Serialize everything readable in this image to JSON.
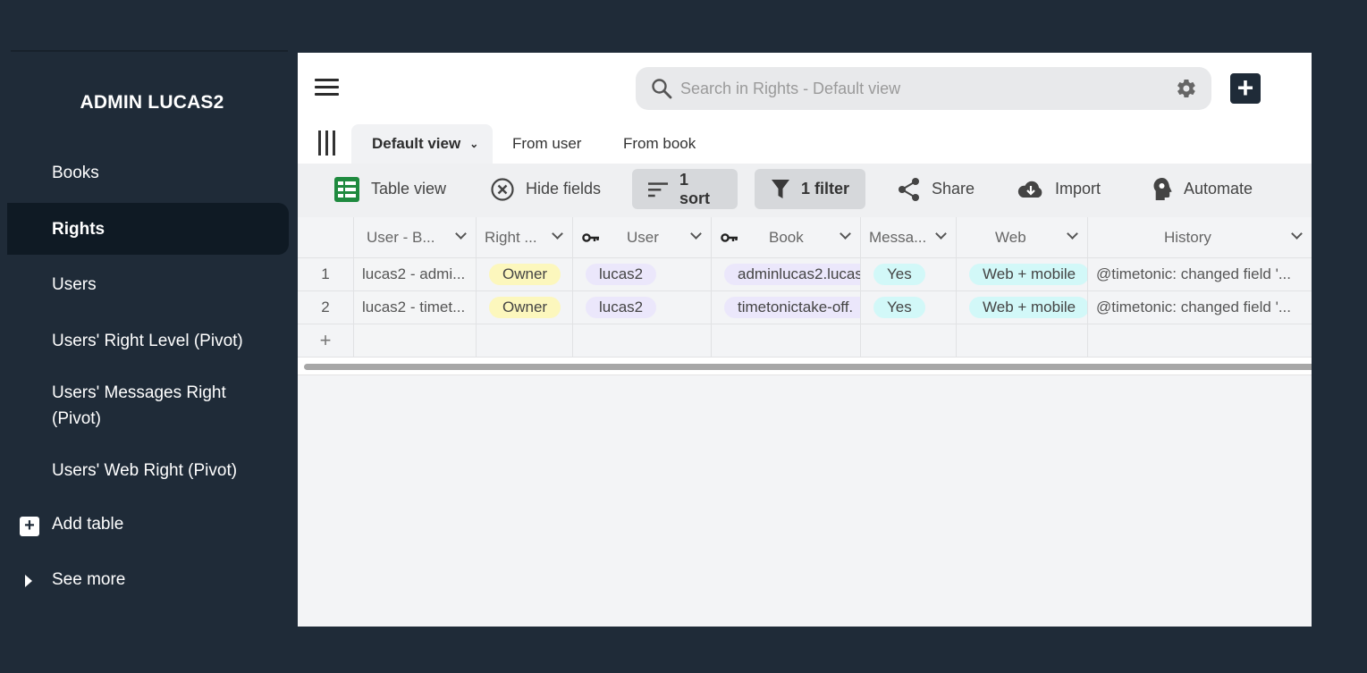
{
  "sidebar": {
    "title": "ADMIN LUCAS2",
    "items": [
      {
        "label": "Books",
        "active": false
      },
      {
        "label": "Rights",
        "active": true
      },
      {
        "label": "Users",
        "active": false
      },
      {
        "label": "Users' Right Level (Pivot)",
        "active": false
      },
      {
        "label": "Users' Messages Right (Pivot)",
        "active": false
      },
      {
        "label": "Users' Web Right (Pivot)",
        "active": false
      }
    ],
    "add_table_label": "Add table",
    "see_more_label": "See more"
  },
  "search": {
    "placeholder": "Search in Rights - Default view"
  },
  "tabs": [
    {
      "label": "Default view",
      "active": true
    },
    {
      "label": "From user",
      "active": false
    },
    {
      "label": "From book",
      "active": false
    }
  ],
  "toolbar": {
    "table_view": "Table view",
    "hide_fields": "Hide fields",
    "sort": "1 sort",
    "filter": "1 filter",
    "share": "Share",
    "import": "Import",
    "automate": "Automate"
  },
  "table": {
    "columns": [
      "User - B...",
      "Right ...",
      "User",
      "Book",
      "Messa...",
      "Web",
      "History"
    ],
    "rows": [
      {
        "num": "1",
        "user_book": "lucas2 - admi...",
        "right": "Owner",
        "user": "lucas2",
        "book": "adminlucas2.lucas",
        "messages": "Yes",
        "web": "Web + mobile",
        "history": "@timetonic: changed field '..."
      },
      {
        "num": "2",
        "user_book": "lucas2 - timet...",
        "right": "Owner",
        "user": "lucas2",
        "book": "timetonictake-off.",
        "messages": "Yes",
        "web": "Web + mobile",
        "history": "@timetonic: changed field '..."
      }
    ],
    "add_row_symbol": "+"
  },
  "colors": {
    "background": "#1f2b38",
    "sidebar_active": "#0f1a24",
    "pill_yellow": "#fcf7bd",
    "pill_lavender": "#ebe7fb",
    "pill_cyan": "#d2f8f8",
    "table_view_icon": "#1f8a3f"
  },
  "icons": [
    "hamburger-icon",
    "search-icon",
    "gear-icon",
    "plus-icon",
    "views-icon",
    "chevron-down-icon",
    "table-icon",
    "hide-icon",
    "sort-icon",
    "filter-icon",
    "share-icon",
    "cloud-download-icon",
    "automate-icon",
    "key-icon",
    "caret-right-icon"
  ]
}
